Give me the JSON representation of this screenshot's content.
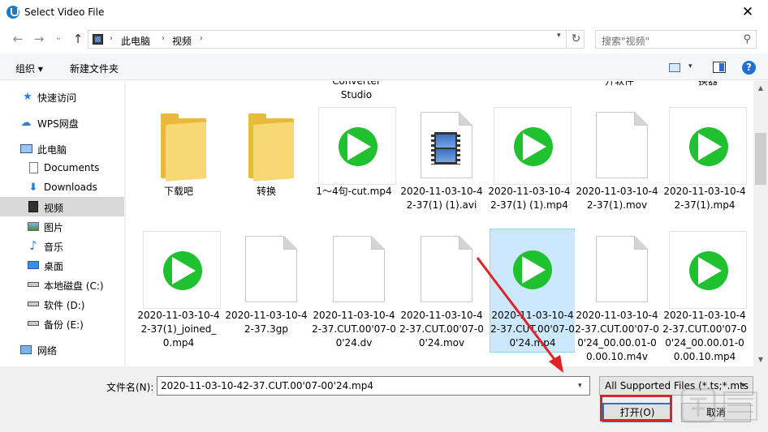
{
  "window": {
    "title": "Select Video File",
    "close_glyph": "✕"
  },
  "nav": {
    "back_glyph": "←",
    "forward_glyph": "→",
    "recent_glyph": "⌄",
    "up_glyph": "↑",
    "breadcrumb": [
      "此电脑",
      "视频"
    ],
    "refresh_glyph": "↻",
    "search_placeholder": "搜索\"视频\"",
    "search_glyph": "⚲"
  },
  "toolbar": {
    "organize": "组织 ▾",
    "new_folder": "新建文件夹",
    "help": "?"
  },
  "sidebar": {
    "items": [
      {
        "label": "快速访问",
        "icon": "star-icon"
      },
      {
        "label": "WPS网盘",
        "icon": "cloud-icon"
      },
      {
        "label": "此电脑",
        "icon": "computer-icon"
      },
      {
        "label": "Documents",
        "icon": "document-icon"
      },
      {
        "label": "Downloads",
        "icon": "download-icon"
      },
      {
        "label": "视频",
        "icon": "video-icon"
      },
      {
        "label": "图片",
        "icon": "picture-icon"
      },
      {
        "label": "音乐",
        "icon": "music-icon"
      },
      {
        "label": "桌面",
        "icon": "desktop-icon"
      },
      {
        "label": "本地磁盘 (C:)",
        "icon": "drive-icon"
      },
      {
        "label": "软件 (D:)",
        "icon": "drive-icon"
      },
      {
        "label": "备份 (E:)",
        "icon": "drive-icon"
      },
      {
        "label": "网络",
        "icon": "network-icon"
      }
    ],
    "selected": "视频"
  },
  "files": {
    "partial_top": [
      "Converter\nStudio",
      "开软件",
      "换器"
    ],
    "row1": [
      {
        "name": "下载吧",
        "kind": "folder"
      },
      {
        "name": "转换",
        "kind": "folder"
      },
      {
        "name": "1～4句-cut.mp4",
        "kind": "video"
      },
      {
        "name": "2020-11-03-10-42-37(1) (1).avi",
        "kind": "film"
      },
      {
        "name": "2020-11-03-10-42-37(1) (1).mp4",
        "kind": "video"
      },
      {
        "name": "2020-11-03-10-42-37(1).mov",
        "kind": "doc"
      },
      {
        "name": "2020-11-03-10-42-37(1).mp4",
        "kind": "video"
      }
    ],
    "row2": [
      {
        "name": "2020-11-03-10-42-37(1)_joined_0.mp4",
        "kind": "video"
      },
      {
        "name": "2020-11-03-10-42-37.3gp",
        "kind": "doc"
      },
      {
        "name": "2020-11-03-10-42-37.CUT.00'07-00'24.dv",
        "kind": "doc"
      },
      {
        "name": "2020-11-03-10-42-37.CUT.00'07-00'24.mov",
        "kind": "doc"
      },
      {
        "name": "2020-11-03-10-42-37.CUT.00'07-00'24.mp4",
        "kind": "video",
        "selected": true
      },
      {
        "name": "2020-11-03-10-42-37.CUT.00'07-00'24_00.00.01-00.00.10.m4v",
        "kind": "doc"
      },
      {
        "name": "2020-11-03-10-42-37.CUT.00'07-00'24_00.00.01-00.00.10.mp4",
        "kind": "video"
      }
    ]
  },
  "bottom": {
    "filename_label": "文件名(N):",
    "filename_value": "2020-11-03-10-42-37.CUT.00'07-00'24.mp4",
    "filter_value": "All Supported Files (*.ts;*.mts",
    "open_label": "打开(O)",
    "cancel_label": "取消"
  },
  "colors": {
    "play_green": "#1fc12f",
    "selection": "#cce8ff",
    "annotation_red": "#e02323",
    "folder_yellow": "#f8d775"
  }
}
